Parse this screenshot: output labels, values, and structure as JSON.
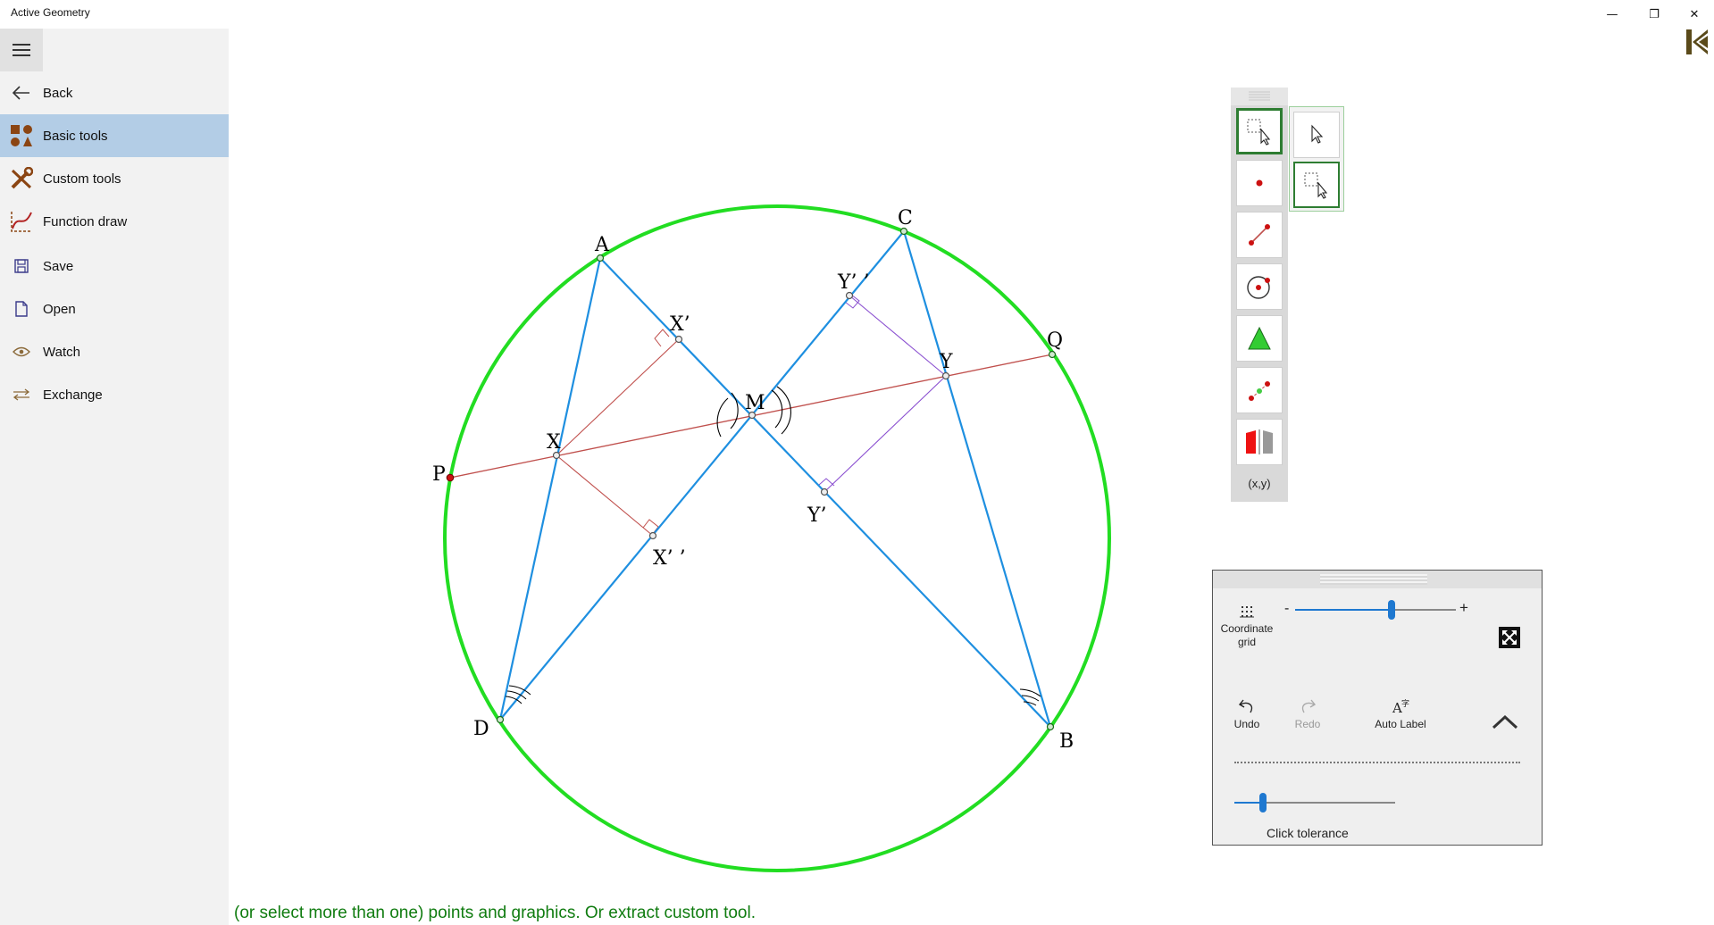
{
  "window": {
    "title": "Active Geometry",
    "minimize": "—",
    "restore": "❐",
    "close": "✕",
    "back_glyph": "K"
  },
  "sidebar": {
    "items": [
      {
        "label": "Back",
        "icon": "back-arrow-icon"
      },
      {
        "label": "Basic tools",
        "icon": "shapes-icon",
        "active": true
      },
      {
        "label": "Custom tools",
        "icon": "tools-icon"
      },
      {
        "label": "Function draw",
        "icon": "function-icon"
      },
      {
        "label": "Save",
        "icon": "save-icon"
      },
      {
        "label": "Open",
        "icon": "open-file-icon"
      },
      {
        "label": "Watch",
        "icon": "eye-icon"
      },
      {
        "label": "Exchange",
        "icon": "exchange-icon"
      }
    ]
  },
  "canvas": {
    "labels": {
      "A": "A",
      "B": "B",
      "C": "C",
      "D": "D",
      "P": "P",
      "Q": "Q",
      "M": "M",
      "X": "X",
      "Y": "Y",
      "Xp": "X’",
      "Xpp": "X’ ’",
      "Yp": "Y’",
      "Ypp": "Y’ ’"
    },
    "colors": {
      "circle": "#22dd22",
      "quad": "#1e8fe0",
      "line_pq": "#c0504d",
      "x_perp": "#c0504d",
      "y_perp": "#8a4fd0",
      "point_fill": "#cfe8cf",
      "p_point": "#cc1111"
    }
  },
  "status": {
    "text": "(or select more than one) points and graphics. Or extract custom tool."
  },
  "toolbox": {
    "tools": [
      "select-icon",
      "point-icon",
      "segment-icon",
      "circle-icon",
      "polygon-icon",
      "points-icon",
      "reflect-icon"
    ],
    "coord_label": "(x,y)",
    "subtools": [
      "pointer-icon",
      "rect-select-icon"
    ]
  },
  "control_panel": {
    "coordinate_grid": "Coordinate grid",
    "zoom_minus": "-",
    "zoom_plus": "+",
    "zoom_level": 0.6,
    "undo": "Undo",
    "redo": "Redo",
    "auto_label": "Auto Label",
    "click_tolerance": "Click tolerance",
    "tolerance_level": 0.18
  }
}
